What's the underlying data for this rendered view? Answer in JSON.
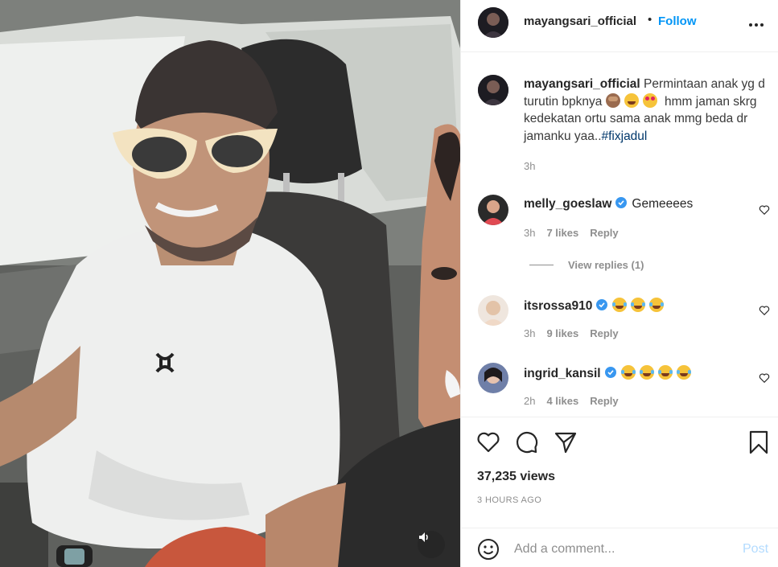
{
  "post": {
    "owner_username": "mayangsari_official",
    "follow_label": "Follow",
    "separator": "•",
    "caption": {
      "username": "mayangsari_official",
      "text_part1": "Permintaan anak yg d turutin bpknya",
      "text_part2": "hmm jaman skrg kedekatan ortu sama anak mmg beda dr jamanku yaa..",
      "hashtag": "#fixjadul",
      "time": "3h"
    },
    "comments": [
      {
        "username": "melly_goeslaw",
        "verified": true,
        "text": "Gemeeees",
        "emoji_count": 0,
        "time": "3h",
        "likes": "7 likes",
        "reply_label": "Reply",
        "view_replies": "View replies (1)"
      },
      {
        "username": "itsrossa910",
        "verified": true,
        "text": "",
        "emoji_count": 3,
        "time": "3h",
        "likes": "9 likes",
        "reply_label": "Reply"
      },
      {
        "username": "ingrid_kansil",
        "verified": true,
        "text": "",
        "emoji_count": 4,
        "time": "2h",
        "likes": "4 likes",
        "reply_label": "Reply"
      }
    ],
    "views": "37,235 views",
    "posted_ago": "3 HOURS AGO"
  },
  "add_comment": {
    "placeholder": "Add a comment...",
    "post_label": "Post"
  },
  "icons": [
    "more-options-icon",
    "heart-icon",
    "comment-icon",
    "share-icon",
    "save-icon",
    "smile-icon",
    "mute-icon",
    "verified-badge-icon"
  ],
  "colors": {
    "link_blue": "#0095f6",
    "text": "#262626",
    "muted": "#8e8e8e",
    "post_disabled": "#b3dbff",
    "verified": "#3897f0"
  }
}
